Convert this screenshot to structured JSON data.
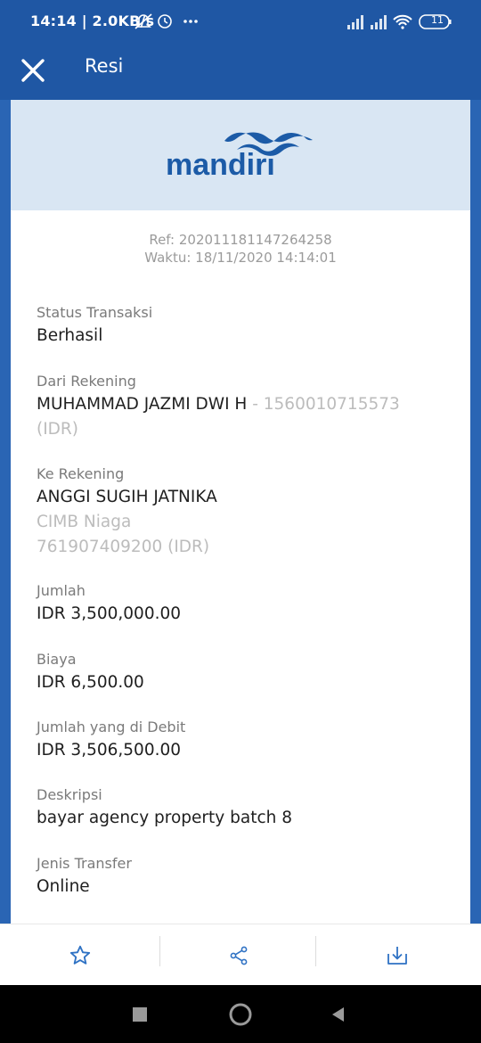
{
  "status_bar": {
    "time": "14:14",
    "speed": "| 2.0KB/s",
    "icons": [
      "muted-bell-icon",
      "alarm-icon",
      "more-dots-icon",
      "signal-icon",
      "signal-icon",
      "wifi-icon",
      "battery-icon"
    ],
    "battery_level": "11"
  },
  "header": {
    "title": "Resi",
    "close_icon": "close-icon",
    "color": "#1f57a4"
  },
  "logo": {
    "text": "mandiri",
    "color": "#1c5ba7"
  },
  "receipt": {
    "ref": "Ref: 202011181147264258",
    "time": "Waktu: 18/11/2020 14:14:01"
  },
  "fields": {
    "status": {
      "label": "Status Transaksi",
      "value": "Berhasil"
    },
    "from": {
      "label": "Dari Rekening",
      "name": "MUHAMMAD JAZMI DWI H",
      "account": " - 1560010715573",
      "currency": "(IDR)"
    },
    "to": {
      "label": "Ke Rekening",
      "name": "ANGGI SUGIH JATNIKA",
      "bank": "CIMB Niaga",
      "account": "761907409200 (IDR)"
    },
    "amount": {
      "label": "Jumlah",
      "value": "IDR 3,500,000.00"
    },
    "fee": {
      "label": "Biaya",
      "value": "IDR 6,500.00"
    },
    "debit": {
      "label": "Jumlah yang di Debit",
      "value": "IDR 3,506,500.00"
    },
    "description": {
      "label": "Deskripsi",
      "value": "bayar agency property batch 8"
    },
    "transfer_type": {
      "label": "Jenis Transfer",
      "value": "Online"
    }
  },
  "actions": {
    "icons": [
      "star-icon",
      "share-icon",
      "download-icon"
    ],
    "color": "#2f72c4"
  },
  "nav": {
    "icons": [
      "recents-square-icon",
      "home-circle-icon",
      "back-triangle-icon"
    ]
  }
}
